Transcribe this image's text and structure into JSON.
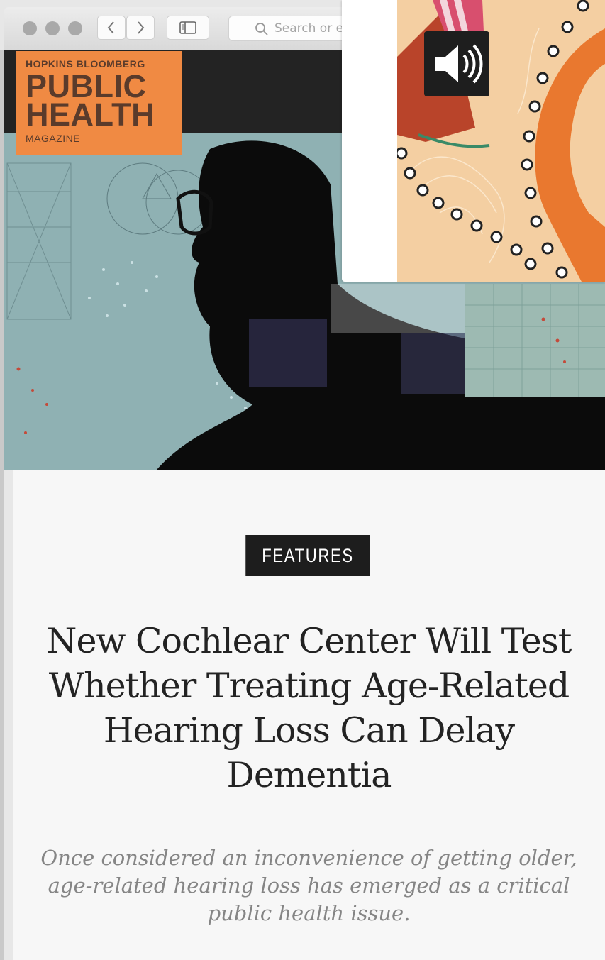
{
  "browser": {
    "back_icon": "chevron-left-icon",
    "forward_icon": "chevron-right-icon",
    "sidebar_icon": "sidebar-icon",
    "search_placeholder": "Search or e"
  },
  "site": {
    "logo_line1": "HOPKINS BLOOMBERG",
    "logo_line2": "PUBLIC",
    "logo_line3": "HEALTH",
    "logo_line4": "MAGAZINE",
    "brand_color": "#f08a43"
  },
  "article": {
    "category": "FEATURES",
    "title": "New Cochlear Center Will Test Whether Treating Age-Related Hearing Loss Can Delay Dementia",
    "subtitle": "Once considered an inconvenience of getting older, age-related hearing loss has emerged as a critical public health issue."
  },
  "popup": {
    "icon": "speaker-icon"
  }
}
